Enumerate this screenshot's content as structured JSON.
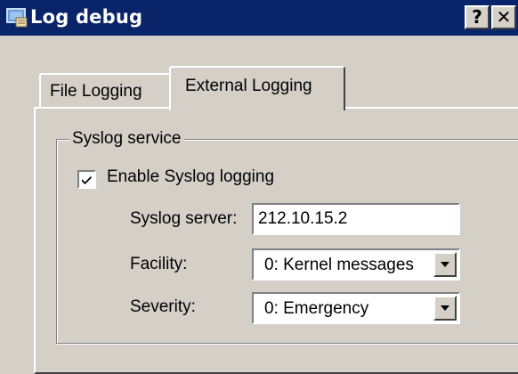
{
  "window": {
    "title": "Log debug",
    "help_button": "?",
    "close_button": "✕",
    "titlebar_color": "#0a246a"
  },
  "tabs": [
    {
      "label": "File Logging",
      "selected": false
    },
    {
      "label": "External Logging",
      "selected": true
    }
  ],
  "syslog": {
    "group_label": "Syslog service",
    "enable_label": "Enable Syslog logging",
    "enabled": true,
    "server_label": "Syslog server:",
    "server_value": "212.10.15.2",
    "facility_label": "Facility:",
    "facility_value": "0: Kernel messages",
    "severity_label": "Severity:",
    "severity_value": "0: Emergency"
  },
  "icons": {
    "app": "log-debug-app-icon",
    "check": "checkmark-icon",
    "dropdown": "chevron-down-icon"
  }
}
